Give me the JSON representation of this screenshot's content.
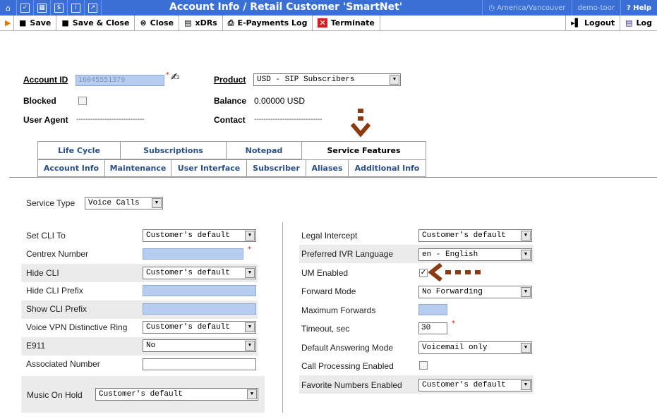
{
  "titlebar": {
    "title": "Account Info / Retail Customer 'SmartNet'",
    "timezone": "America/Vancouver",
    "user": "demo-toor",
    "help": "Help",
    "icons": [
      "home-icon",
      "check-icon",
      "grid-icon",
      "dollar-icon",
      "info-icon",
      "chart-icon"
    ]
  },
  "toolbar": {
    "save": "Save",
    "save_close": "Save & Close",
    "close": "Close",
    "xdrs": "xDRs",
    "epayments": "E-Payments Log",
    "terminate": "Terminate",
    "logout": "Logout",
    "log": "Log"
  },
  "account": {
    "id_label": "Account ID",
    "id_value": "16045551379",
    "product_label": "Product",
    "product_value": "USD - SIP Subscribers",
    "blocked_label": "Blocked",
    "balance_label": "Balance",
    "balance_value": "0.00000 USD",
    "user_agent_label": "User Agent",
    "user_agent_value": "-----------------------------",
    "contact_label": "Contact",
    "contact_value": "-----------------------------"
  },
  "tabs_row1": [
    "Life Cycle",
    "Subscriptions",
    "Notepad",
    "Service Features"
  ],
  "tabs_row2": [
    "Account Info",
    "Maintenance",
    "User Interface",
    "Subscriber",
    "Aliases",
    "Additional Info"
  ],
  "service": {
    "type_label": "Service Type",
    "type_value": "Voice Calls"
  },
  "left_fields": {
    "set_cli": {
      "label": "Set CLI To",
      "value": "Customer's default"
    },
    "centrex": {
      "label": "Centrex Number"
    },
    "hide_cli": {
      "label": "Hide CLI",
      "value": "Customer's default"
    },
    "hide_prefix": {
      "label": "Hide CLI Prefix"
    },
    "show_prefix": {
      "label": "Show CLI Prefix"
    },
    "vpn_ring": {
      "label": "Voice VPN Distinctive Ring",
      "value": "Customer's default"
    },
    "e911": {
      "label": "E911",
      "value": "No"
    },
    "assoc": {
      "label": "Associated Number"
    },
    "moh": {
      "label": "Music On Hold",
      "value": "Customer's default"
    }
  },
  "right_fields": {
    "legal": {
      "label": "Legal Intercept",
      "value": "Customer's default"
    },
    "ivr_lang": {
      "label": "Preferred IVR Language",
      "value": "en - English"
    },
    "um": {
      "label": "UM Enabled",
      "checked": true
    },
    "fwd_mode": {
      "label": "Forward Mode",
      "value": "No Forwarding"
    },
    "max_fwd": {
      "label": "Maximum Forwards"
    },
    "timeout": {
      "label": "Timeout, sec",
      "value": "30"
    },
    "answer_mode": {
      "label": "Default Answering Mode",
      "value": "Voicemail only"
    },
    "call_proc": {
      "label": "Call Processing Enabled",
      "checked": false
    },
    "fav_numbers": {
      "label": "Favorite Numbers Enabled",
      "value": "Customer's default"
    }
  },
  "colors": {
    "titlebar": "#3a6fd6",
    "arrow": "#8b3a12",
    "input_fill": "#b6cdef"
  }
}
